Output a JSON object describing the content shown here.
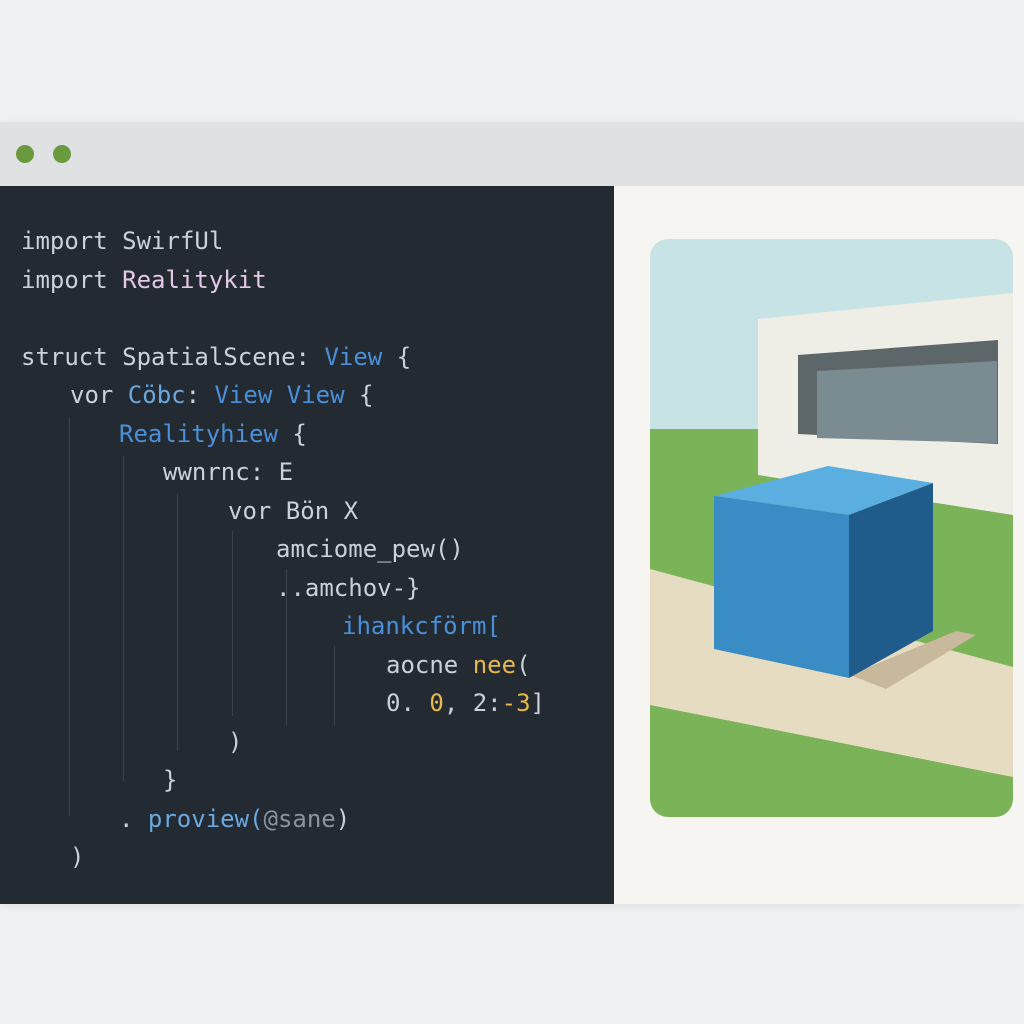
{
  "colors": {
    "background": "#eff1f3",
    "titlebar": "#e0e1e2",
    "traffic_light": "#6a9a3e",
    "editor_bg": "#232a31",
    "sky": "#c7e3e6",
    "grass": "#7bb358",
    "wall": "#efeee6",
    "window_frame": "#5d6668",
    "window_glass": "#7a8c92",
    "floor": "#e6dcc1",
    "cube_front": "#3a8cc4",
    "cube_top": "#5aaee0",
    "cube_side": "#1f5c8c",
    "shadow": "#c8b89c"
  },
  "window": {
    "traffic_lights": [
      {
        "name": "close-dot-icon"
      },
      {
        "name": "minimize-dot-icon"
      }
    ]
  },
  "editor": {
    "lines": [
      {
        "indent": 0,
        "tokens": [
          {
            "t": "import ",
            "c": "#c9d1d9"
          },
          {
            "t": "SwirfUl",
            "c": "#c9d1d9"
          }
        ]
      },
      {
        "indent": 0,
        "tokens": [
          {
            "t": "import ",
            "c": "#c9d1d9"
          },
          {
            "t": "Realitykit",
            "c": "#e2c8e6"
          }
        ]
      },
      {
        "indent": 0,
        "tokens": []
      },
      {
        "indent": 0,
        "tokens": [
          {
            "t": "struct ",
            "c": "#c9d1d9"
          },
          {
            "t": "SpatialScene: ",
            "c": "#c9d1d9"
          },
          {
            "t": "View",
            "c": "#4a90d9"
          },
          {
            "t": " {",
            "c": "#c9d1d9"
          }
        ]
      },
      {
        "indent": 1,
        "tokens": [
          {
            "t": "vor ",
            "c": "#c9d1d9"
          },
          {
            "t": "Cöbc",
            "c": "#6aa8e0"
          },
          {
            "t": ": ",
            "c": "#c9d1d9"
          },
          {
            "t": "View View",
            "c": "#4a90d9"
          },
          {
            "t": " {",
            "c": "#c9d1d9"
          }
        ]
      },
      {
        "indent": 2,
        "tokens": [
          {
            "t": "Realityhiew",
            "c": "#4a90d9"
          },
          {
            "t": " {",
            "c": "#c9d1d9"
          }
        ]
      },
      {
        "indent": 3,
        "tokens": [
          {
            "t": "wwnrnc: E",
            "c": "#c9d1d9"
          }
        ]
      },
      {
        "indent": 4,
        "tokens": [
          {
            "t": "vor ",
            "c": "#c9d1d9"
          },
          {
            "t": "Bön ",
            "c": "#c9d1d9"
          },
          {
            "t": "X",
            "c": "#c9d1d9"
          }
        ]
      },
      {
        "indent": 5,
        "tokens": [
          {
            "t": "amciome_pew()",
            "c": "#c9d1d9"
          }
        ]
      },
      {
        "indent": 5,
        "tokens": [
          {
            "t": "..amchov-}",
            "c": "#c9d1d9"
          }
        ]
      },
      {
        "indent": 6,
        "tokens": [
          {
            "t": "ihankcförm[",
            "c": "#4a90d9"
          }
        ]
      },
      {
        "indent": 7,
        "tokens": [
          {
            "t": "aocne ",
            "c": "#c9d1d9"
          },
          {
            "t": "nee",
            "c": "#e5b94a"
          },
          {
            "t": "(",
            "c": "#c9d1d9"
          }
        ]
      },
      {
        "indent": 7,
        "tokens": [
          {
            "t": "0. ",
            "c": "#c9d1d9"
          },
          {
            "t": "0",
            "c": "#e5b94a"
          },
          {
            "t": ", ",
            "c": "#c9d1d9"
          },
          {
            "t": "2:",
            "c": "#c9d1d9"
          },
          {
            "t": "-3",
            "c": "#e5b94a"
          },
          {
            "t": "]",
            "c": "#c9d1d9"
          }
        ]
      },
      {
        "indent": 4,
        "tokens": [
          {
            "t": ")",
            "c": "#c9d1d9"
          }
        ]
      },
      {
        "indent": 3,
        "tokens": [
          {
            "t": "}",
            "c": "#c9d1d9"
          }
        ]
      },
      {
        "indent": 2,
        "tokens": [
          {
            "t": ". ",
            "c": "#c9d1d9"
          },
          {
            "t": "proview(",
            "c": "#6aa8e0"
          },
          {
            "t": "@sane",
            "c": "#8a94a0"
          },
          {
            "t": ")",
            "c": "#c9d1d9"
          }
        ]
      },
      {
        "indent": 1,
        "tokens": [
          {
            "t": ")",
            "c": "#c9d1d9"
          }
        ]
      }
    ]
  }
}
